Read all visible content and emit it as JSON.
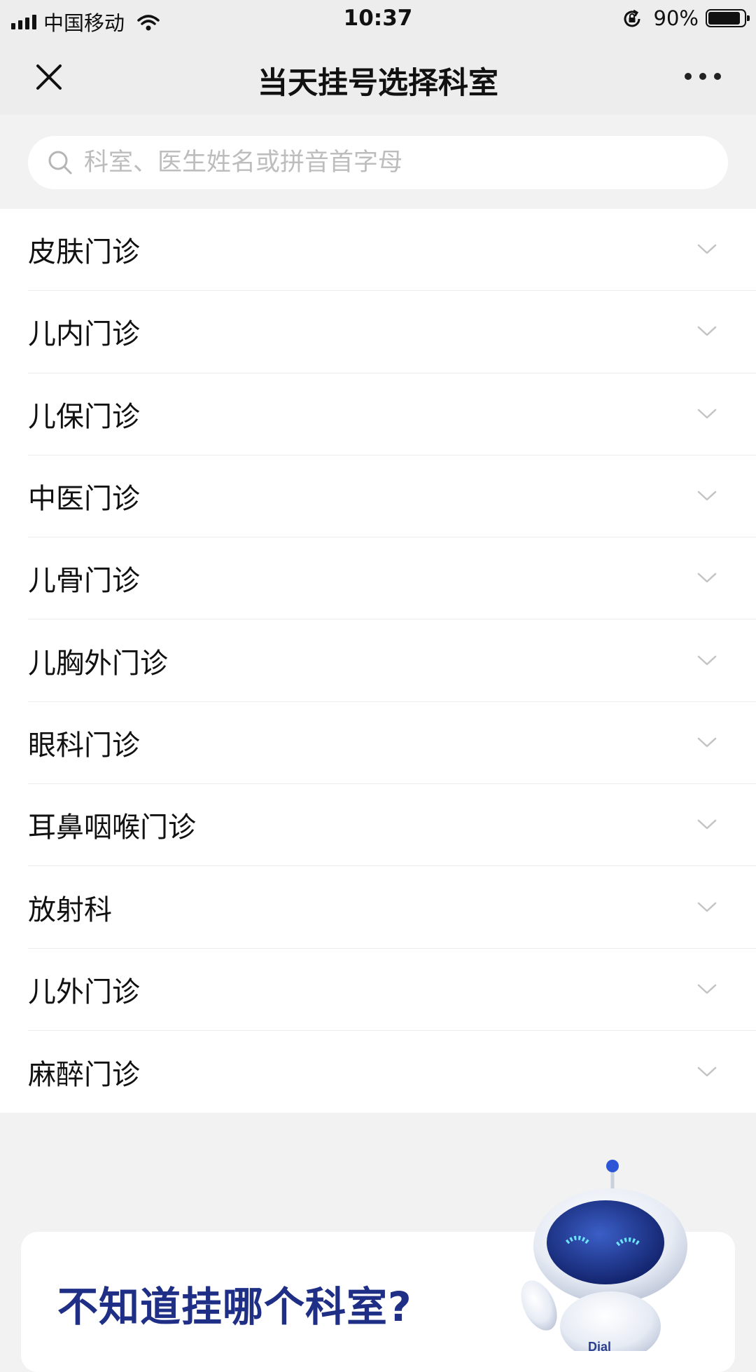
{
  "status_bar": {
    "carrier": "中国移动",
    "time": "10:37",
    "battery_percent": "90%",
    "battery_level": 0.9,
    "icons": [
      "signal-icon",
      "wifi-icon",
      "rotation-lock-icon",
      "battery-icon"
    ]
  },
  "nav": {
    "title": "当天挂号选择科室",
    "close_icon": "close-icon",
    "more_icon": "more-icon"
  },
  "search": {
    "placeholder": "科室、医生姓名或拼音首字母",
    "value": "",
    "icon": "search-icon"
  },
  "departments": [
    {
      "label": "皮肤门诊"
    },
    {
      "label": "儿内门诊"
    },
    {
      "label": "儿保门诊"
    },
    {
      "label": "中医门诊"
    },
    {
      "label": "儿骨门诊"
    },
    {
      "label": "儿胸外门诊"
    },
    {
      "label": "眼科门诊"
    },
    {
      "label": "耳鼻咽喉门诊"
    },
    {
      "label": "放射科"
    },
    {
      "label": "儿外门诊"
    },
    {
      "label": "麻醉门诊"
    }
  ],
  "help_banner": {
    "title": "不知道挂哪个科室?",
    "robot_badge": "Dial"
  },
  "colors": {
    "nav_background": "#ededed",
    "page_background": "#f2f2f3",
    "list_background": "#ffffff",
    "help_title": "#1f2f86",
    "placeholder": "#bdbdbd",
    "chevron": "#c4c4c4"
  }
}
